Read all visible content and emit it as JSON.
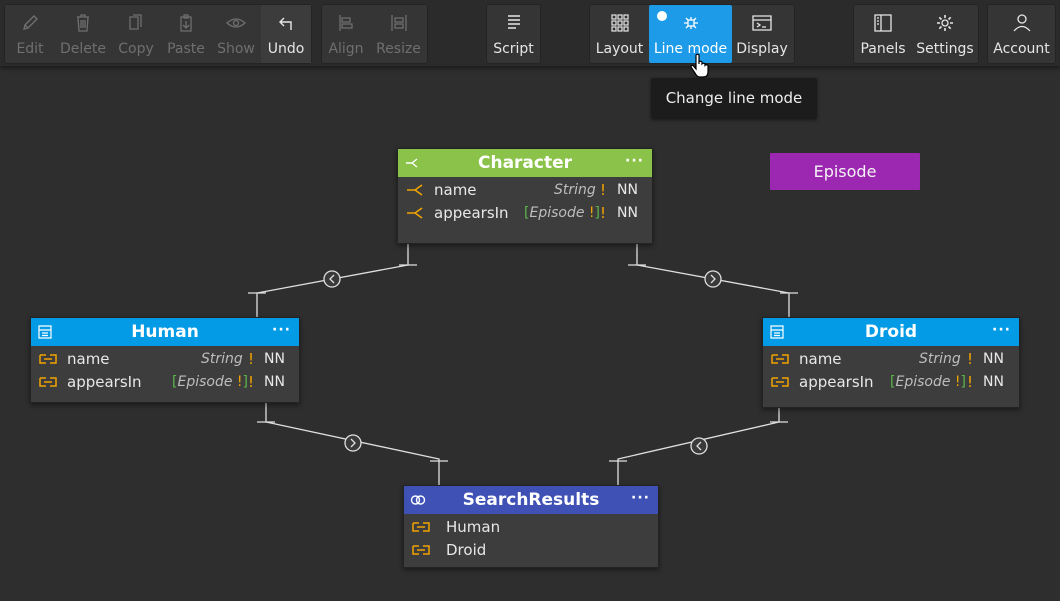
{
  "toolbar": {
    "edit_group": {
      "edit": "Edit",
      "delete": "Delete",
      "copy": "Copy",
      "paste": "Paste",
      "show": "Show",
      "undo": "Undo"
    },
    "arrange_group": {
      "align": "Align",
      "resize": "Resize"
    },
    "script": "Script",
    "view_group": {
      "layout": "Layout",
      "line_mode": "Line mode",
      "display": "Display"
    },
    "app_group": {
      "panels": "Panels",
      "settings": "Settings"
    },
    "account": "Account",
    "active_color": "#1e9be8"
  },
  "tooltip": "Change line mode",
  "diagram": {
    "character": {
      "title": "Character",
      "header_color": "#8bc34a",
      "more": "···",
      "fields": [
        {
          "name": "name",
          "type": "String",
          "required": "!",
          "nn": "NN"
        },
        {
          "name": "appearsIn",
          "type_open": "[",
          "type": "Episode",
          "type_req": "!",
          "type_close": "]",
          "required": "!",
          "nn": "NN"
        }
      ]
    },
    "human": {
      "title": "Human",
      "header_color": "#039be5",
      "more": "···",
      "fields": [
        {
          "name": "name",
          "type": "String",
          "required": "!",
          "nn": "NN"
        },
        {
          "name": "appearsIn",
          "type_open": "[",
          "type": "Episode",
          "type_req": "!",
          "type_close": "]",
          "required": "!",
          "nn": "NN"
        }
      ]
    },
    "droid": {
      "title": "Droid",
      "header_color": "#039be5",
      "more": "···",
      "fields": [
        {
          "name": "name",
          "type": "String",
          "required": "!",
          "nn": "NN"
        },
        {
          "name": "appearsIn",
          "type_open": "[",
          "type": "Episode",
          "type_req": "!",
          "type_close": "]",
          "required": "!",
          "nn": "NN"
        }
      ]
    },
    "search_results": {
      "title": "SearchResults",
      "header_color": "#3f51b5",
      "more": "···",
      "members": [
        "Human",
        "Droid"
      ]
    },
    "episode": {
      "title": "Episode",
      "color": "#9c27b0"
    },
    "field_icon_color": "#f0a400",
    "line_color": "#e0e0e0"
  }
}
